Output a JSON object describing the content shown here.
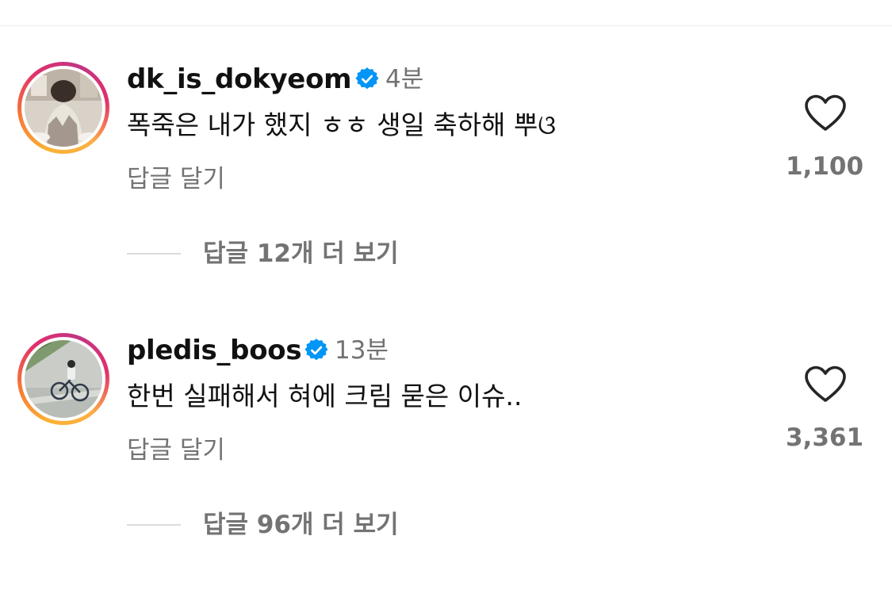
{
  "comments": [
    {
      "username": "dk_is_dokyeom",
      "verified": true,
      "time": "4분",
      "text": "폭죽은 내가 했지 ㅎㅎ 생일 축하해 뿌ଓ",
      "reply_label": "답글 달기",
      "view_replies": "답글 12개 더 보기",
      "likes": "1,100",
      "avatar_icon": "profile-photo-icon"
    },
    {
      "username": "pledis_boos",
      "verified": true,
      "time": "13분",
      "text": "한번 실패해서 혀에 크림 묻은 이슈..",
      "reply_label": "답글 달기",
      "view_replies": "답글 96개 더 보기",
      "likes": "3,361",
      "avatar_icon": "profile-photo-icon"
    }
  ],
  "colors": {
    "text_primary": "#111111",
    "text_secondary": "#737373",
    "verified_blue": "#0095f6",
    "story_ring": [
      "#f9b233",
      "#e1306c",
      "#c13584"
    ],
    "divider": "#dbdbdb"
  }
}
